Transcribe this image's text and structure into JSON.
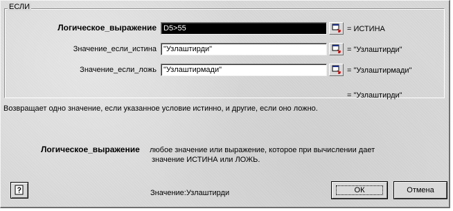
{
  "dialog": {
    "function_name": "ЕСЛИ"
  },
  "arguments": [
    {
      "label": "Логическое_выражение",
      "value": "D5>55",
      "result": "= ИСТИНА",
      "focused": true
    },
    {
      "label": "Значение_если_истина",
      "value": "\"Узлаштирди\"",
      "result": "= \"Узлаштирди\"",
      "focused": false
    },
    {
      "label": "Значение_если_ложь",
      "value": "\"Узлаштирмади\"",
      "result": "= \"Узлаштирмади\"",
      "focused": false
    }
  ],
  "formula_result": "= \"Узлаштирди\"",
  "description": "Возвращает одно значение, если указанное условие истинно, и другие, если оно ложно.",
  "argument_help": {
    "name": "Логическое_выражение",
    "text_line1": "любое значение или выражение, которое при вычислении дает",
    "text_line2": "значение ИСТИНА или ЛОЖЬ."
  },
  "footer": {
    "help_icon": "help-icon",
    "value_label": "Значение:Узлаштирди",
    "ok_label": "ОК",
    "cancel_label": "Отмена"
  },
  "colors": {
    "dialog_bg": "#d9d9d9",
    "field_bg": "#ffffff",
    "focused_field_bg": "#000000"
  }
}
